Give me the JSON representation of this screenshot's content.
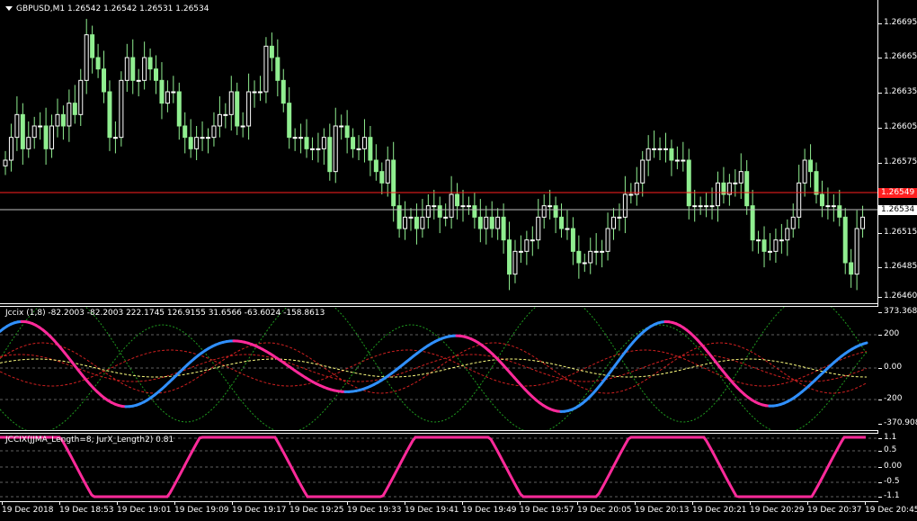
{
  "symbol_header": {
    "arrow_icon": "triangle-down-icon",
    "text": "GBPUSD,M1  1.26542 1.26542 1.26531 1.26534"
  },
  "price_axis": [
    "1.26695",
    "1.26665",
    "1.26635",
    "1.26605",
    "1.26575",
    "1.26545",
    "1.26534",
    "1.26515",
    "1.26485",
    "1.26460"
  ],
  "price_tags": {
    "red": "1.26549",
    "white": "1.26534"
  },
  "jccix_header": "Jccix (1,8) -82.2003 -82.2003 222.1745 126.9155 31.6566 -63.6024 -158.8613",
  "jccix_axis": [
    "373.3687",
    "200",
    "0.00",
    "-200",
    "-370.9087"
  ],
  "jccix2_header": "JCCIX(JJMA_Length=8, JurX_Length2) 0.81",
  "jccix2_axis": [
    "1.1",
    "0.5",
    "0.00",
    "-0.5",
    "-1.1"
  ],
  "time_axis": [
    "19 Dec 2018",
    "19 Dec 18:53",
    "19 Dec 19:01",
    "19 Dec 19:09",
    "19 Dec 19:17",
    "19 Dec 19:25",
    "19 Dec 19:33",
    "19 Dec 19:41",
    "19 Dec 19:49",
    "19 Dec 19:57",
    "19 Dec 20:05",
    "19 Dec 20:13",
    "19 Dec 20:21",
    "19 Dec 20:29",
    "19 Dec 20:37",
    "19 Dec 20:45"
  ],
  "colors": {
    "bull": "#ffffff",
    "bear": "#90ee90",
    "red_line": "#ff2020",
    "white_line": "#c0c0c0",
    "cci_up": "#3090ff",
    "cci_down": "#ff2a9a",
    "yellow": "#ffff80",
    "green_dash": "#1f9b1f"
  },
  "candles_close": [
    1.2658,
    1.266,
    1.2662,
    1.2659,
    1.266,
    1.2661,
    1.2661,
    1.2659,
    1.2661,
    1.2662,
    1.2661,
    1.2663,
    1.2662,
    1.2665,
    1.2669,
    1.2667,
    1.2666,
    1.2664,
    1.266,
    1.266,
    1.2665,
    1.2667,
    1.2665,
    1.2665,
    1.2667,
    1.2666,
    1.2665,
    1.2663,
    1.2664,
    1.2664,
    1.2661,
    1.266,
    1.2659,
    1.266,
    1.266,
    1.266,
    1.2661,
    1.2662,
    1.2662,
    1.2664,
    1.2661,
    1.2661,
    1.2664,
    1.2664,
    1.2664,
    1.2668,
    1.2667,
    1.2665,
    1.2663,
    1.266,
    1.266,
    1.266,
    1.2659,
    1.2659,
    1.2659,
    1.266,
    1.2657,
    1.2661,
    1.2661,
    1.266,
    1.2659,
    1.2659,
    1.266,
    1.2658,
    1.2657,
    1.2656,
    1.2658,
    1.2654,
    1.2652,
    1.2653,
    1.2653,
    1.2652,
    1.2653,
    1.2654,
    1.2654,
    1.2653,
    1.2653,
    1.2655,
    1.2654,
    1.2654,
    1.2654,
    1.2653,
    1.2652,
    1.2653,
    1.2652,
    1.2653,
    1.2651,
    1.2648,
    1.265,
    1.265,
    1.2651,
    1.2651,
    1.2653,
    1.2654,
    1.2654,
    1.2653,
    1.2652,
    1.2652,
    1.265,
    1.2649,
    1.2649,
    1.265,
    1.265,
    1.265,
    1.2652,
    1.2653,
    1.2653,
    1.2655,
    1.2655,
    1.2656,
    1.2658,
    1.2659,
    1.2659,
    1.2659,
    1.2659,
    1.2658,
    1.2658,
    1.2658,
    1.2654,
    1.2654,
    1.2654,
    1.2654,
    1.2654,
    1.2656,
    1.2655,
    1.2656,
    1.2656,
    1.2657,
    1.2654,
    1.2651,
    1.2651,
    1.265,
    1.265,
    1.2651,
    1.2651,
    1.2652,
    1.2653,
    1.2656,
    1.2658,
    1.2657,
    1.2655,
    1.2654,
    1.2654,
    1.2654,
    1.2653,
    1.2649,
    1.2648,
    1.2652,
    1.2653
  ]
}
